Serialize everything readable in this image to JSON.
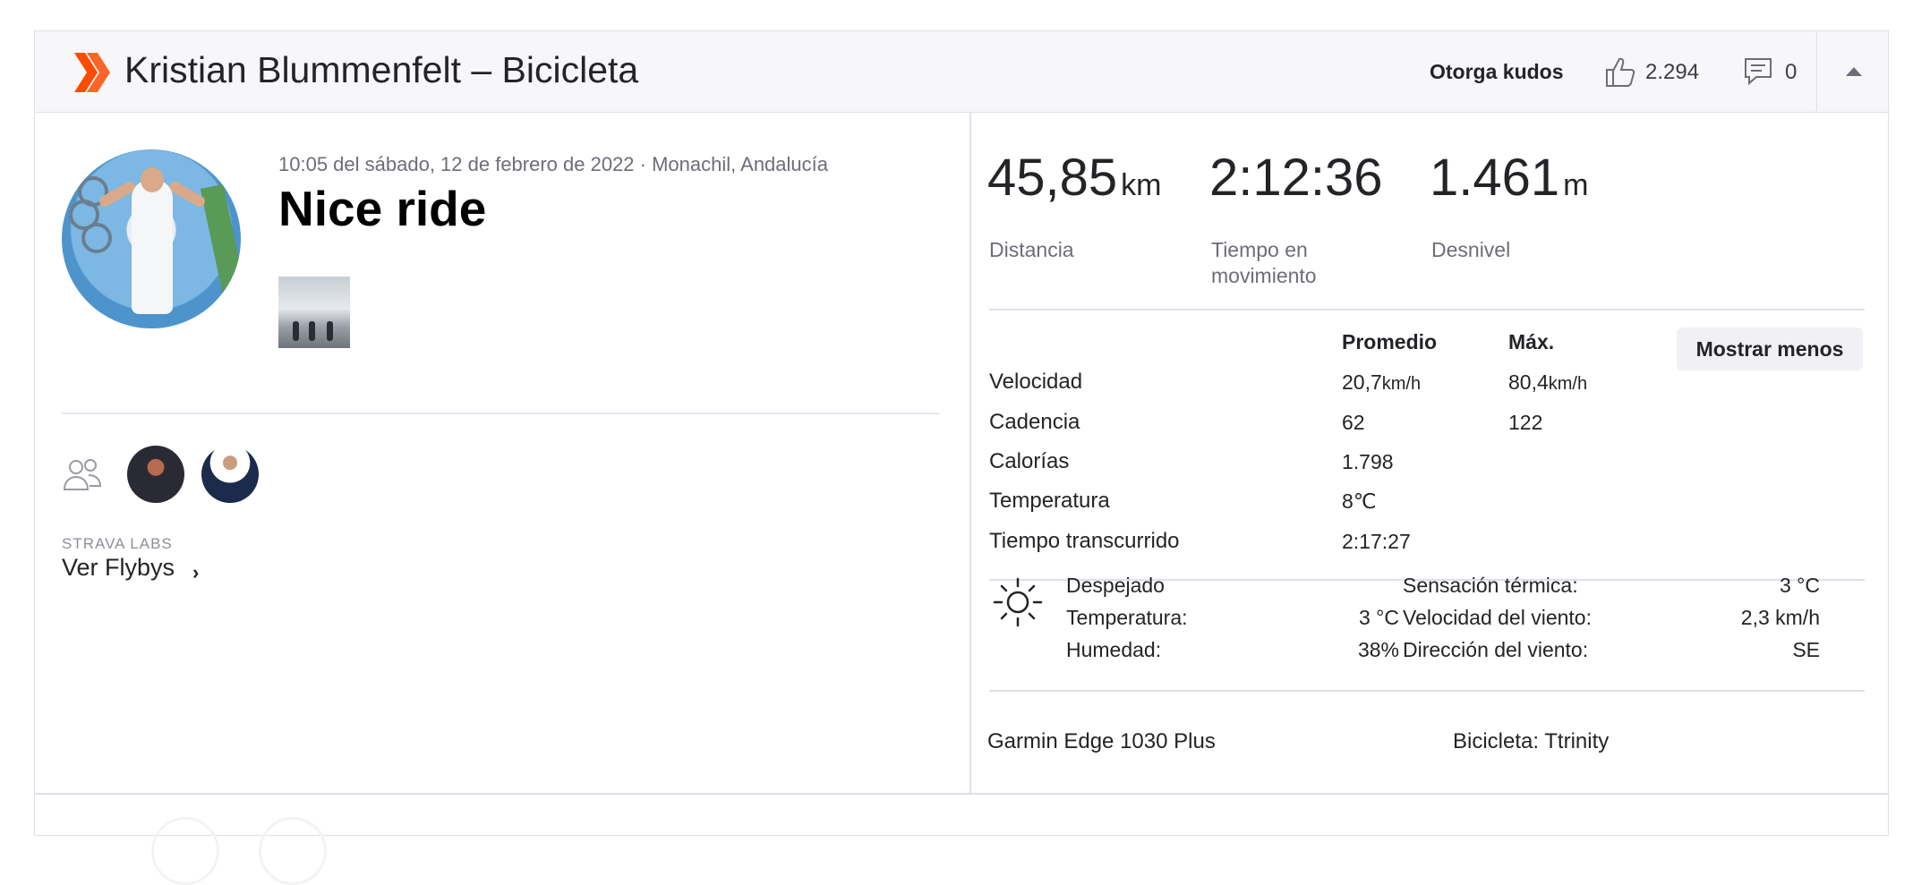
{
  "header": {
    "title": "Kristian Blummenfelt – Bicicleta",
    "kudos_button": "Otorga kudos",
    "kudos_count": "2.294",
    "comment_count": "0",
    "sport_icon": "ride-chevron-icon",
    "accent_color": "#fc4c02"
  },
  "activity": {
    "meta": "10:05 del sábado, 12 de febrero de 2022 · Monachil, Andalucía",
    "title": "Nice ride"
  },
  "flyby": {
    "labs_label": "STRAVA LABS",
    "link": "Ver Flybys",
    "chevron": "›"
  },
  "stats": {
    "distance": {
      "value": "45,85",
      "unit": "km",
      "label": "Distancia"
    },
    "moving_time": {
      "value": "2:12:36",
      "label_line1": "Tiempo en",
      "label_line2": "movimiento"
    },
    "elevation": {
      "value": "1.461",
      "unit": "m",
      "label": "Desnivel"
    }
  },
  "more": {
    "col_avg": "Promedio",
    "col_max": "Máx.",
    "toggle_button": "Mostrar menos",
    "rows": [
      {
        "label": "Velocidad",
        "avg": "20,7",
        "avg_unit": "km/h",
        "max": "80,4",
        "max_unit": "km/h"
      },
      {
        "label": "Cadencia",
        "avg": "62",
        "avg_unit": "",
        "max": "122",
        "max_unit": ""
      },
      {
        "label": "Calorías",
        "avg": "1.798",
        "avg_unit": "",
        "max": "",
        "max_unit": ""
      },
      {
        "label": "Temperatura",
        "avg": "8℃",
        "avg_unit": "",
        "max": "",
        "max_unit": ""
      },
      {
        "label": "Tiempo transcurrido",
        "avg": "2:17:27",
        "avg_unit": "",
        "max": "",
        "max_unit": ""
      }
    ]
  },
  "weather": {
    "icon": "sun-icon",
    "condition": "Despejado",
    "temp_label": "Temperatura:",
    "temp_value": "3 °C",
    "humidity_label": "Humedad:",
    "humidity_value": "38%",
    "feels_label": "Sensación térmica:",
    "feels_value": "3 °C",
    "wind_speed_label": "Velocidad del viento:",
    "wind_speed_value": "2,3 km/h",
    "wind_dir_label": "Dirección del viento:",
    "wind_dir_value": "SE"
  },
  "gear": {
    "device": "Garmin Edge 1030 Plus",
    "bike": "Bicicleta: Ttrinity"
  }
}
